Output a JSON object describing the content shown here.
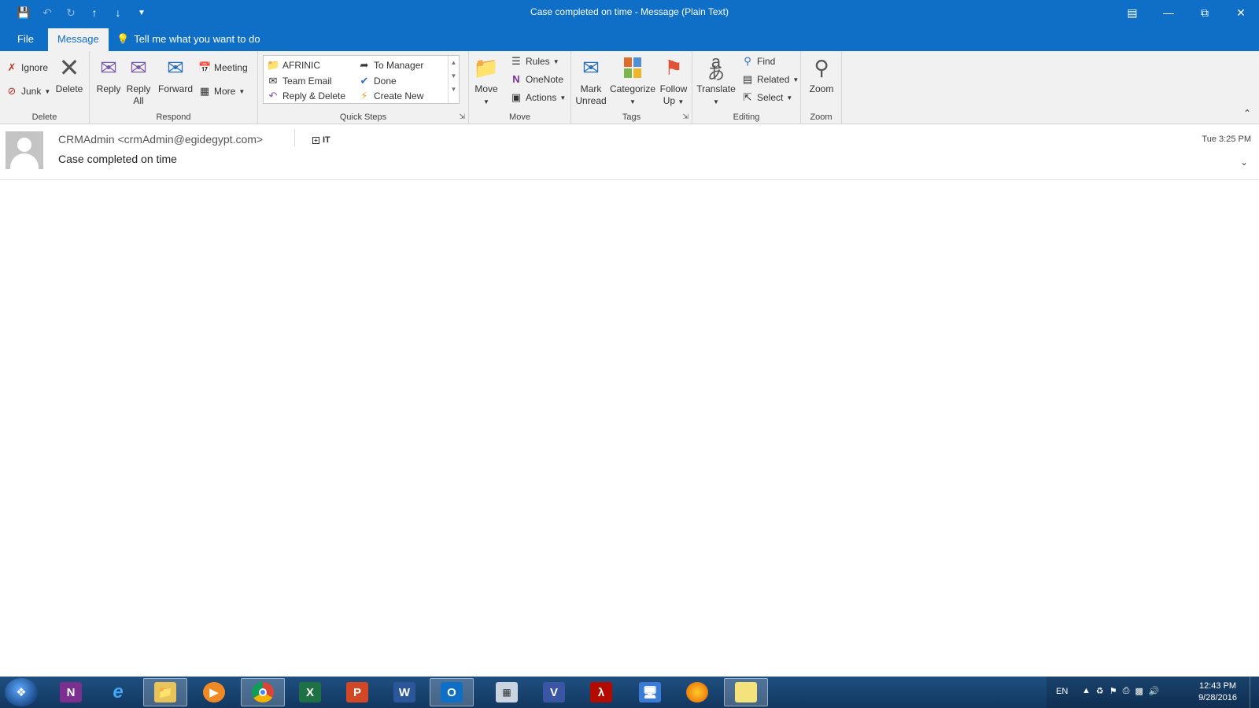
{
  "window": {
    "title": "Case completed on time - Message (Plain Text)"
  },
  "menu": {
    "file": "File",
    "message": "Message",
    "tell_me": "Tell me what you want to do"
  },
  "ribbon": {
    "delete_group": {
      "label": "Delete",
      "ignore": "Ignore",
      "junk": "Junk",
      "delete": "Delete"
    },
    "respond_group": {
      "label": "Respond",
      "reply": "Reply",
      "reply_all_1": "Reply",
      "reply_all_2": "All",
      "forward": "Forward",
      "meeting": "Meeting",
      "more": "More"
    },
    "quick_steps": {
      "label": "Quick Steps",
      "items": [
        "AFRINIC",
        "Team Email",
        "Reply & Delete",
        "To Manager",
        "Done",
        "Create New"
      ]
    },
    "move_group": {
      "label": "Move",
      "move": "Move",
      "rules": "Rules",
      "onenote": "OneNote",
      "actions": "Actions"
    },
    "tags_group": {
      "label": "Tags",
      "mark_unread_1": "Mark",
      "mark_unread_2": "Unread",
      "categorize": "Categorize",
      "follow_up_1": "Follow",
      "follow_up_2": "Up"
    },
    "editing_group": {
      "label": "Editing",
      "translate": "Translate",
      "find": "Find",
      "related": "Related",
      "select": "Select"
    },
    "zoom_group": {
      "label": "Zoom",
      "zoom": "Zoom"
    }
  },
  "message": {
    "sender": "CRMAdmin <crmAdmin@egidegypt.com>",
    "category": "IT",
    "subject": "Case completed on time",
    "time": "Tue 3:25 PM"
  },
  "taskbar": {
    "tray": {
      "lang": "EN",
      "time": "12:43 PM",
      "date": "9/28/2016"
    }
  },
  "colors": {
    "accent": "#0f6fc6",
    "ribbon": "#f1f1f1",
    "taskbar": "#1f4f80"
  }
}
